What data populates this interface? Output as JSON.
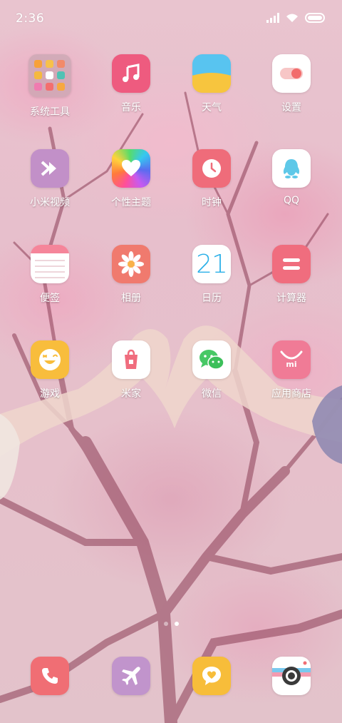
{
  "status_bar": {
    "time": "2:36"
  },
  "apps": [
    {
      "id": "folder-tools",
      "label": "系统工具"
    },
    {
      "id": "music",
      "label": "音乐"
    },
    {
      "id": "weather",
      "label": "天气"
    },
    {
      "id": "settings",
      "label": "设置"
    },
    {
      "id": "mi-video",
      "label": "小米视频"
    },
    {
      "id": "themes",
      "label": "个性主题"
    },
    {
      "id": "clock",
      "label": "时钟"
    },
    {
      "id": "qq",
      "label": "QQ"
    },
    {
      "id": "notes",
      "label": "便签"
    },
    {
      "id": "gallery",
      "label": "相册"
    },
    {
      "id": "calendar",
      "label": "日历",
      "day": "21"
    },
    {
      "id": "calculator",
      "label": "计算器"
    },
    {
      "id": "games",
      "label": "游戏"
    },
    {
      "id": "mijia",
      "label": "米家"
    },
    {
      "id": "wechat",
      "label": "微信"
    },
    {
      "id": "app-store",
      "label": "应用商店",
      "badge_text": "mi"
    }
  ],
  "pages": {
    "count": 2,
    "current": 2
  },
  "dock": [
    {
      "id": "phone",
      "icon": "phone-icon"
    },
    {
      "id": "browser",
      "icon": "airplane-icon"
    },
    {
      "id": "messages",
      "icon": "message-heart-icon"
    },
    {
      "id": "camera",
      "icon": "camera-icon"
    }
  ],
  "colors": {
    "music": "#ee5b7f",
    "weather_top": "#58c4f0",
    "weather_bottom": "#f7c53e",
    "settings_toggle": "#f26c6c",
    "mi_video": "#c290c8",
    "clock": "#ef6c7a",
    "qq": "#5ec8e8",
    "notes_top": "#f5859a",
    "gallery": "#f07a6e",
    "calendar_digits": "#2ab0e8",
    "calculator": "#f06d7e",
    "games": "#f8bd3c",
    "wechat": "#47c865",
    "app_store": "#f07b96",
    "phone": "#f06e74",
    "browser": "#c194cc",
    "messages": "#f7bd3a"
  }
}
